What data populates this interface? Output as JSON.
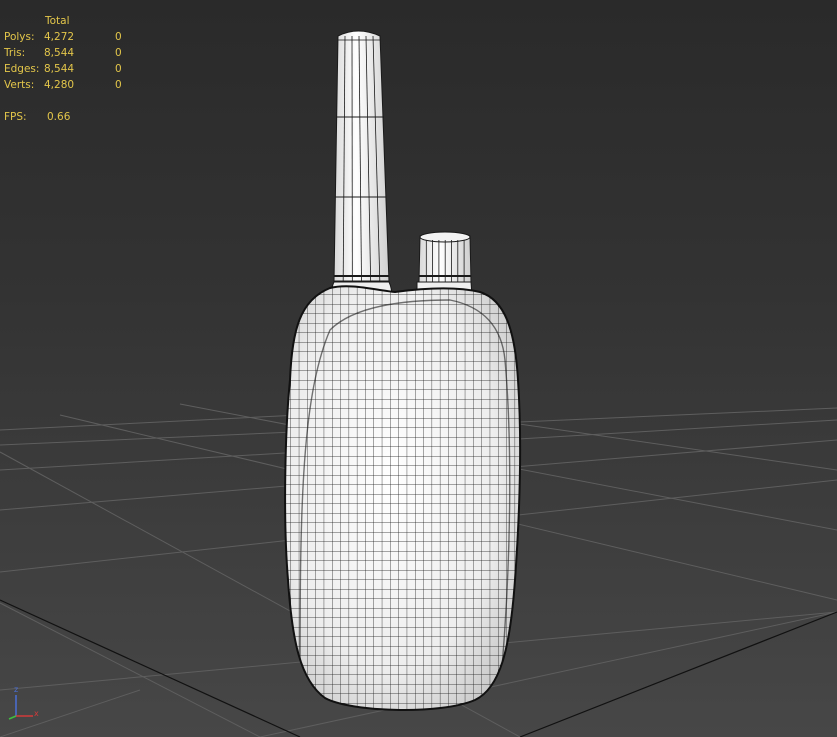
{
  "viewport": {
    "stats": {
      "header": "Total",
      "rows": [
        {
          "label": "Polys:",
          "total": "4,272",
          "selected": "0"
        },
        {
          "label": "Tris:",
          "total": "8,544",
          "selected": "0"
        },
        {
          "label": "Edges:",
          "total": "8,544",
          "selected": "0"
        },
        {
          "label": "Verts:",
          "total": "4,280",
          "selected": "0"
        }
      ],
      "fps_label": "FPS:",
      "fps_value": "0.66"
    },
    "axis_gizmo": {
      "x_label": "x",
      "z_label": "z"
    },
    "colors": {
      "stats_text": "#e3c64a",
      "grid_line": "#5e5e5e",
      "mesh_fill": "#f2f2f2",
      "wire": "#1a1a1a",
      "axis_x": "#d23a3a",
      "axis_y": "#3fbf3f",
      "axis_z": "#4a6fd6"
    }
  }
}
